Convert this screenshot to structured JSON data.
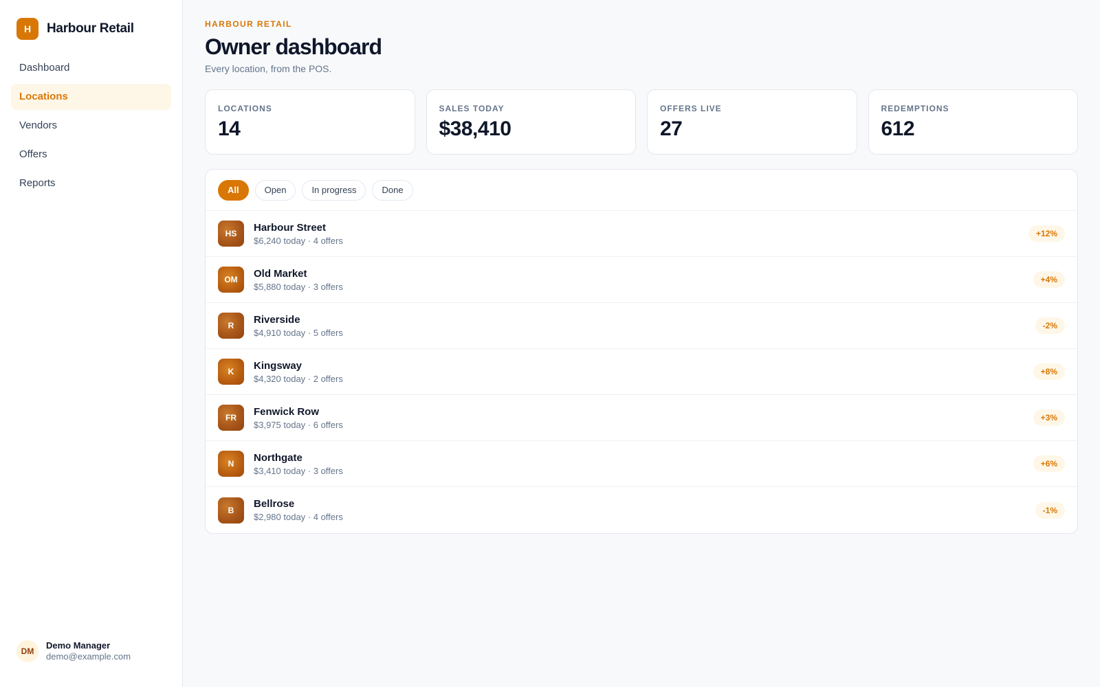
{
  "brand": {
    "initial": "H",
    "name": "Harbour Retail"
  },
  "nav": {
    "items": [
      {
        "label": "Dashboard"
      },
      {
        "label": "Locations"
      },
      {
        "label": "Vendors"
      },
      {
        "label": "Offers"
      },
      {
        "label": "Reports"
      }
    ],
    "active_index": 1
  },
  "user": {
    "initials": "DM",
    "name": "Demo Manager",
    "email": "demo@example.com"
  },
  "header": {
    "eyebrow": "HARBOUR RETAIL",
    "title": "Owner dashboard",
    "subtitle": "Every location, from the POS."
  },
  "stats": [
    {
      "label": "LOCATIONS",
      "value": "14"
    },
    {
      "label": "SALES TODAY",
      "value": "$38,410"
    },
    {
      "label": "OFFERS LIVE",
      "value": "27"
    },
    {
      "label": "REDEMPTIONS",
      "value": "612"
    }
  ],
  "filters": {
    "chips": [
      {
        "label": "All"
      },
      {
        "label": "Open"
      },
      {
        "label": "In progress"
      },
      {
        "label": "Done"
      }
    ],
    "selected": "All"
  },
  "locations": [
    {
      "initials": "HS",
      "name": "Harbour Street",
      "meta": "$6,240 today · 4 offers",
      "trend": "+12%"
    },
    {
      "initials": "OM",
      "name": "Old Market",
      "meta": "$5,880 today · 3 offers",
      "trend": "+4%"
    },
    {
      "initials": "R",
      "name": "Riverside",
      "meta": "$4,910 today · 5 offers",
      "trend": "-2%"
    },
    {
      "initials": "K",
      "name": "Kingsway",
      "meta": "$4,320 today · 2 offers",
      "trend": "+8%"
    },
    {
      "initials": "FR",
      "name": "Fenwick Row",
      "meta": "$3,975 today · 6 offers",
      "trend": "+3%"
    },
    {
      "initials": "N",
      "name": "Northgate",
      "meta": "$3,410 today · 3 offers",
      "trend": "+6%"
    },
    {
      "initials": "B",
      "name": "Bellrose",
      "meta": "$2,980 today · 4 offers",
      "trend": "-1%"
    }
  ],
  "colors": {
    "accent": "#d97706",
    "accent_soft": "#fef7e8",
    "text": "#0f172a",
    "muted": "#64748b"
  }
}
